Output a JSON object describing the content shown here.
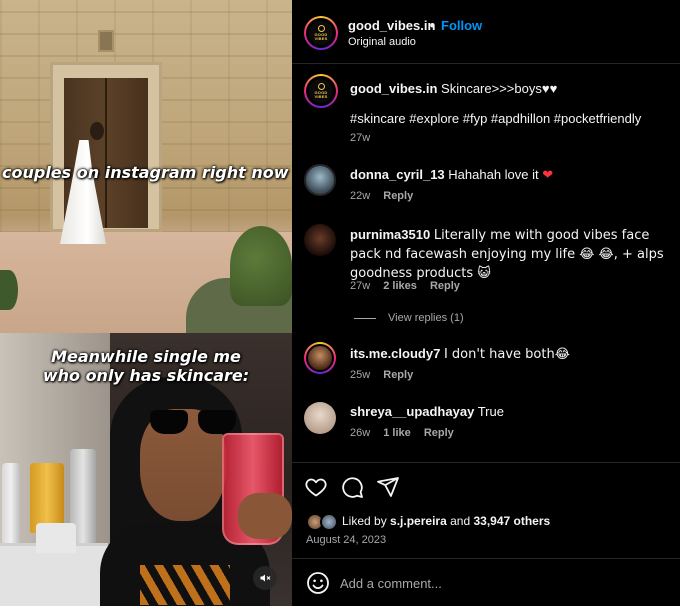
{
  "media": {
    "caption_top": "couples on instagram right now",
    "caption_bottom_line1": "Meanwhile single me",
    "caption_bottom_line2": "who only has skincare:",
    "mute_icon": "speaker-muted-icon"
  },
  "header": {
    "username": "good_vibes.in",
    "separator": "•",
    "follow_label": "Follow",
    "subtitle": "Original audio",
    "logo_text_line1": "GOOD",
    "logo_text_line2": "VIBES"
  },
  "caption": {
    "username": "good_vibes.in",
    "text": "Skincare>>>boys♥♥",
    "hashtags": "#skincare #explore #fyp #apdhillon #pocketfriendly",
    "time": "27w"
  },
  "comments": [
    {
      "username": "donna_cyril_13",
      "text": "Hahahah love it",
      "emoji": "❤",
      "time": "22w",
      "likes": "",
      "reply_label": "Reply"
    },
    {
      "username": "purnima3510",
      "text": "Literally me with good vibes face pack nd facewash enjoying my life 😂 😂, + alps goodness products 😺",
      "time": "27w",
      "likes": "2 likes",
      "reply_label": "Reply"
    },
    {
      "username": "its.me.cloudy7",
      "text": "I don't have both😂",
      "time": "25w",
      "likes": "",
      "reply_label": "Reply"
    },
    {
      "username": "shreya__upadhayay",
      "text": "True",
      "time": "26w",
      "likes": "1 like",
      "reply_label": "Reply"
    }
  ],
  "view_replies": "View replies (1)",
  "actions": {
    "like_icon": "heart-outline-icon",
    "comment_icon": "comment-bubble-icon",
    "share_icon": "paper-plane-icon",
    "liked_by_prefix": "Liked by",
    "liked_by_user": "s.j.pereira",
    "liked_by_and": "and",
    "liked_by_others": "33,947 others",
    "date": "August 24, 2023"
  },
  "add_comment": {
    "placeholder": "Add a comment...",
    "emoji_icon": "smiley-icon"
  },
  "colors": {
    "background": "#000000",
    "text": "#f5f5f5",
    "muted": "#a8a8a8",
    "follow_blue": "#0095f6",
    "divider": "#262626",
    "heart_red": "#ff3040"
  }
}
